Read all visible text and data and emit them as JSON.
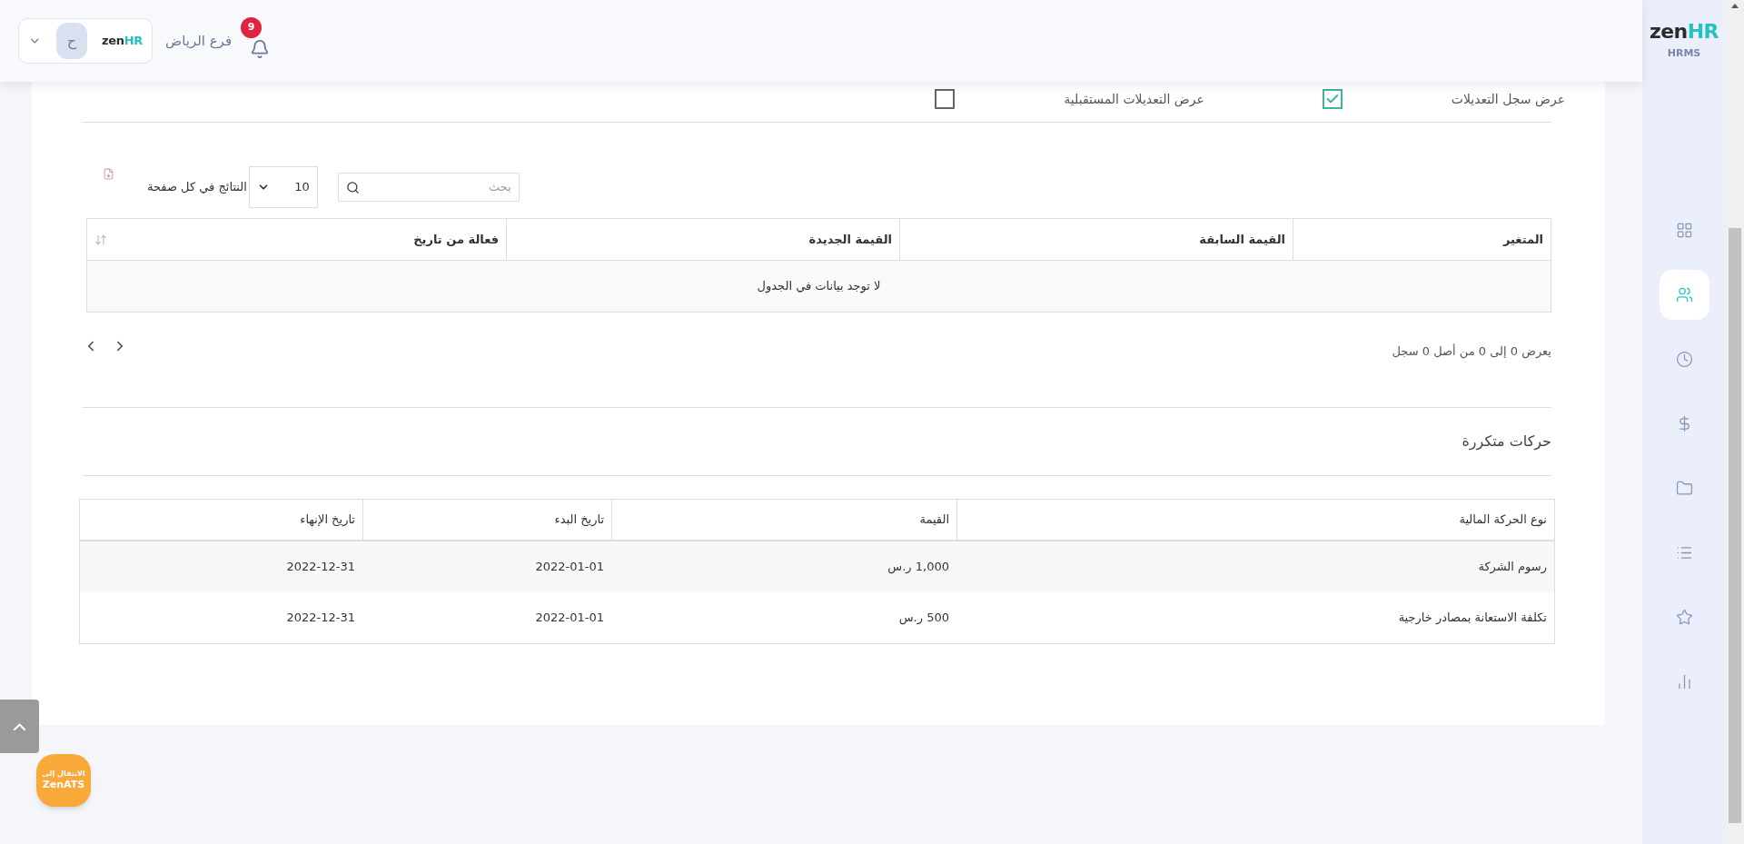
{
  "header": {
    "notification_count": "9",
    "branch": "فرع الرياض",
    "logo": {
      "dark": "zen",
      "accent": "HR"
    },
    "avatar_initial": "ح"
  },
  "sidebar": {
    "logo": {
      "dark": "zen",
      "accent": "HR",
      "product": "HRMS"
    },
    "items": [
      {
        "selected": false
      },
      {
        "selected": true
      },
      {
        "selected": false
      },
      {
        "selected": false
      },
      {
        "selected": false
      },
      {
        "selected": false
      },
      {
        "selected": false
      },
      {
        "selected": false
      }
    ]
  },
  "checkboxes": [
    {
      "label": "عرض سجل التعديلات",
      "checked": true
    },
    {
      "label": "عرض التعديلات المستقبلية",
      "checked": false
    }
  ],
  "history_table": {
    "search": {
      "placeholder": "بحث"
    },
    "page_size": {
      "value": "10",
      "label": "النتائج في كل صفحة"
    },
    "columns": [
      "المتغير",
      "القيمة السابقة",
      "القيمة الجديدة",
      "فعالة من تاريخ"
    ],
    "empty_message": "لا توجد بيانات في الجدول",
    "info": "يعرض 0 إلى 0 من أصل 0 سجل"
  },
  "recurring": {
    "title": "حركات متكررة",
    "columns": [
      "نوع الحركة المالية",
      "القيمة",
      "تاريخ البدء",
      "تاريخ الإنهاء"
    ],
    "rows": [
      [
        "رسوم الشركة",
        "1,000 ر.س",
        "2022-01-01",
        "2022-12-31"
      ],
      [
        "تكلفة الاستعانة بمصادر خارجية",
        "500 ر.س",
        "2022-01-01",
        "2022-12-31"
      ]
    ]
  },
  "zenats": {
    "line1": "الانتقال إلى",
    "line2": "ZenATS"
  }
}
